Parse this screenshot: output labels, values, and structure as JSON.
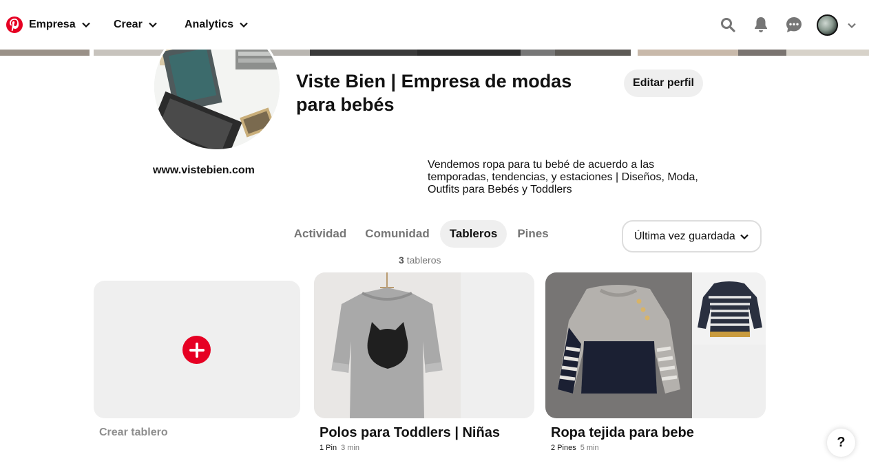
{
  "nav": {
    "business_label": "Empresa",
    "create_label": "Crear",
    "analytics_label": "Analytics"
  },
  "profile": {
    "name": "Viste Bien | Empresa de modas para bebés",
    "edit_label": "Editar perfil",
    "website": "www.vistebien.com",
    "bio": "Vendemos ropa para tu bebé de acuerdo a las temporadas, tendencias, y estaciones | Diseños, Moda, Outfits para Bebés y Toddlers"
  },
  "tabs": [
    {
      "label": "Actividad"
    },
    {
      "label": "Comunidad"
    },
    {
      "label": "Tableros",
      "active": true
    },
    {
      "label": "Pines"
    }
  ],
  "sort": {
    "label": "Última vez guardada"
  },
  "boards_count": {
    "number": "3",
    "label": "tableros"
  },
  "create_board": {
    "label": "Crear tablero"
  },
  "boards": [
    {
      "title": "Polos para Toddlers | Niñas",
      "pins": "1 Pin",
      "time": "3 min"
    },
    {
      "title": "Ropa tejida para bebe",
      "pins": "2 Pines",
      "time": "5 min"
    }
  ],
  "help_label": "?",
  "colors": {
    "brand": "#e60023",
    "tab_active_bg": "#efefef",
    "muted_text": "#767676"
  },
  "icons": [
    "pinterest-logo-icon",
    "search-icon",
    "bell-icon",
    "chat-icon",
    "chevron-down-icon",
    "plus-icon"
  ]
}
